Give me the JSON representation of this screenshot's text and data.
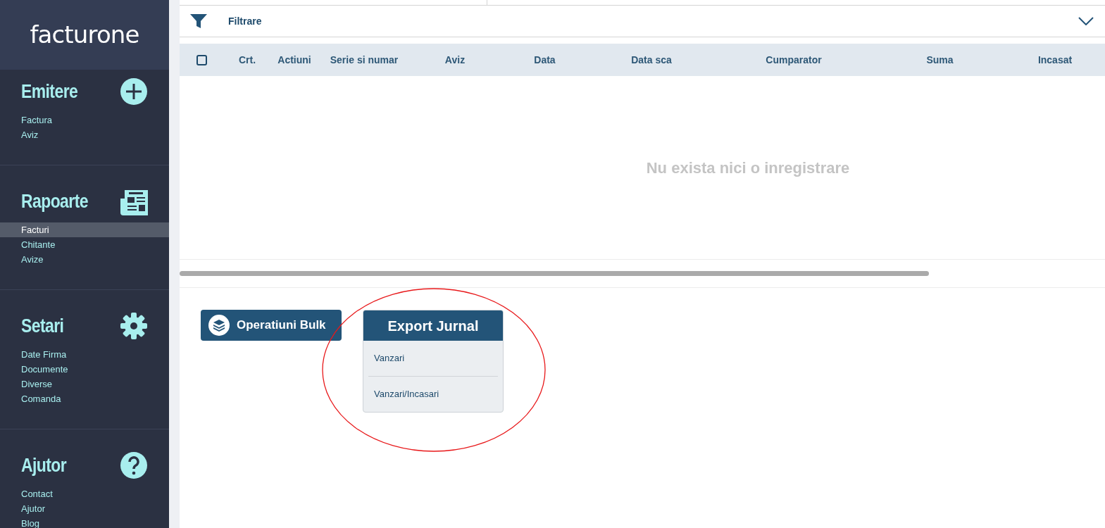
{
  "sidebar": {
    "logo": "facturone",
    "sections": [
      {
        "title": "Emitere",
        "kind": "plus",
        "items": [
          {
            "label": "Factura",
            "selected": false
          },
          {
            "label": "Aviz",
            "selected": false
          }
        ]
      },
      {
        "title": "Rapoarte",
        "kind": "report",
        "items": [
          {
            "label": "Facturi",
            "selected": true
          },
          {
            "label": "Chitante",
            "selected": false
          },
          {
            "label": "Avize",
            "selected": false
          }
        ]
      },
      {
        "title": "Setari",
        "kind": "gear",
        "items": [
          {
            "label": "Date Firma",
            "selected": false
          },
          {
            "label": "Documente",
            "selected": false
          },
          {
            "label": "Diverse",
            "selected": false
          },
          {
            "label": "Comanda",
            "selected": false
          }
        ]
      },
      {
        "title": "Ajutor",
        "kind": "help",
        "items": [
          {
            "label": "Contact",
            "selected": false
          },
          {
            "label": "Ajutor",
            "selected": false
          },
          {
            "label": "Blog",
            "selected": false
          }
        ]
      }
    ]
  },
  "filter": {
    "label": "Filtrare",
    "expanded": false
  },
  "table": {
    "select_all": {
      "checked": false
    },
    "columns": [
      "Crt.",
      "Actiuni",
      "Serie si numar",
      "Aviz",
      "Data",
      "Data sca",
      "Cumparator",
      "Suma",
      "Incasat"
    ],
    "empty_message": "Nu exista nici o inregistrare"
  },
  "bulk_button": {
    "label": "Operatiuni Bulk"
  },
  "export_menu": {
    "title": "Export Jurnal",
    "items": [
      "Vanzari",
      "Vanzari/Incasari"
    ]
  }
}
